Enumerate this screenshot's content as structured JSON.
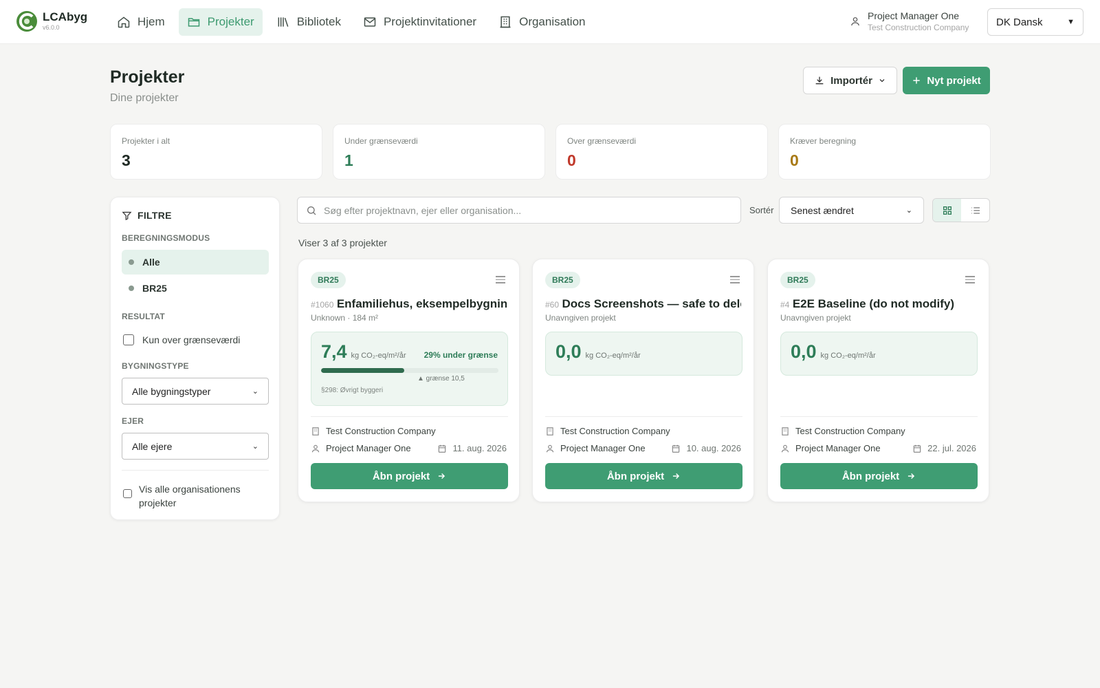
{
  "app": {
    "name": "LCAbyg",
    "version": "v6.0.0"
  },
  "nav": [
    {
      "label": "Hjem",
      "icon": "home-icon"
    },
    {
      "label": "Projekter",
      "icon": "folder-icon",
      "active": true
    },
    {
      "label": "Bibliotek",
      "icon": "library-icon"
    },
    {
      "label": "Projektinvitationer",
      "icon": "mail-icon"
    },
    {
      "label": "Organisation",
      "icon": "building-icon"
    }
  ],
  "user": {
    "name": "Project Manager One",
    "org": "Test Construction Company"
  },
  "language": {
    "label": "DK Dansk"
  },
  "header": {
    "title": "Projekter",
    "subtitle": "Dine projekter",
    "import_label": "Importér",
    "new_label": "Nyt projekt"
  },
  "stats": [
    {
      "label": "Projekter i alt",
      "value": "3",
      "color": "#1f2a24"
    },
    {
      "label": "Under grænseværdi",
      "value": "1",
      "color": "#2e7d58"
    },
    {
      "label": "Over grænseværdi",
      "value": "0",
      "color": "#c0392b"
    },
    {
      "label": "Kræver beregning",
      "value": "0",
      "color": "#a87a16"
    }
  ],
  "filters": {
    "title": "FILTRE",
    "calc_mode_label": "BEREGNINGSMODUS",
    "calc_modes": [
      {
        "label": "Alle",
        "active": true
      },
      {
        "label": "BR25",
        "active": false
      }
    ],
    "result_label": "RESULTAT",
    "over_limit_label": "Kun over grænseværdi",
    "building_type_label": "BYGNINGSTYPE",
    "building_type_value": "Alle bygningstyper",
    "owner_label": "EJER",
    "owner_value": "Alle ejere",
    "show_all_label": "Vis alle organisationens projekter"
  },
  "toolbar": {
    "search_placeholder": "Søg efter projektnavn, ejer eller organisation...",
    "sort_label": "Sortér",
    "sort_value": "Senest ændret",
    "showing": "Viser 3 af 3 projekter"
  },
  "projects": [
    {
      "badge": "BR25",
      "id": "#1060",
      "name": "Enfamiliehus, eksempelbygning",
      "subtitle": "Unknown · 184 m²",
      "value": "7,4",
      "unit": "kg CO₂-eq/m²/år",
      "percent_label": "29% under grænse",
      "progress": 0.47,
      "limit_label": "▲ grænse 10,5",
      "note": "§298: Øvrigt byggeri",
      "org": "Test Construction Company",
      "owner": "Project Manager One",
      "date": "11. aug. 2026",
      "open_label": "Åbn projekt"
    },
    {
      "badge": "BR25",
      "id": "#60",
      "name": "Docs Screenshots — safe to delete",
      "subtitle": "Unavngiven projekt",
      "value": "0,0",
      "unit": "kg CO₂-eq/m²/år",
      "org": "Test Construction Company",
      "owner": "Project Manager One",
      "date": "10. aug. 2026",
      "open_label": "Åbn projekt"
    },
    {
      "badge": "BR25",
      "id": "#4",
      "name": "E2E Baseline (do not modify)",
      "subtitle": "Unavngiven projekt",
      "value": "0,0",
      "unit": "kg CO₂-eq/m²/år",
      "org": "Test Construction Company",
      "owner": "Project Manager One",
      "date": "22. jul. 2026",
      "open_label": "Åbn projekt"
    }
  ]
}
